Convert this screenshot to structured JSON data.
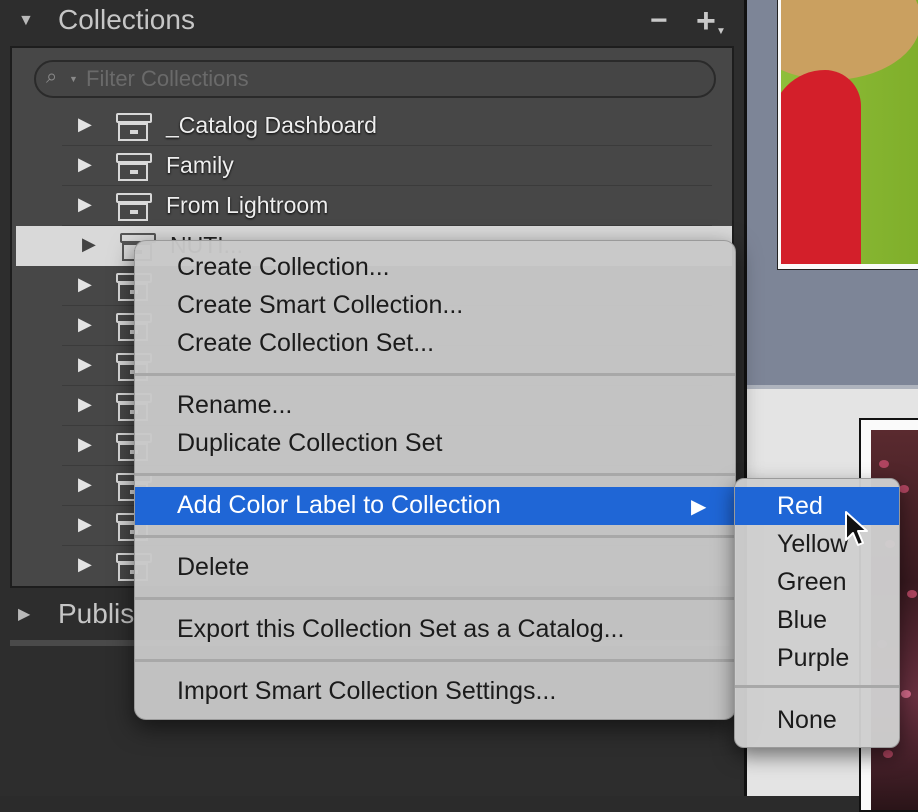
{
  "collections_panel": {
    "title": "Collections",
    "minus_symbol": "−",
    "plus_symbol": "+",
    "filter_placeholder": "Filter Collections",
    "rows": [
      {
        "label": "_Catalog Dashboard"
      },
      {
        "label": "Family"
      },
      {
        "label": "From Lightroom"
      },
      {
        "label": "NUTI..."
      },
      {
        "label": ""
      },
      {
        "label": ""
      },
      {
        "label": ""
      },
      {
        "label": ""
      },
      {
        "label": ""
      },
      {
        "label": ""
      },
      {
        "label": ""
      },
      {
        "label": ""
      }
    ]
  },
  "publish_panel": {
    "title": "Publis"
  },
  "context_menu": {
    "items": [
      "Create Collection...",
      "Create Smart Collection...",
      "Create Collection Set...",
      "Rename...",
      "Duplicate Collection Set",
      "Add Color Label to Collection",
      "Delete",
      "Export this Collection Set as a Catalog...",
      "Import Smart Collection Settings..."
    ],
    "highlighted_item": "Add Color Label to Collection"
  },
  "color_submenu": {
    "items": [
      "Red",
      "Yellow",
      "Green",
      "Blue",
      "Purple",
      "None"
    ],
    "highlighted_item": "Red"
  },
  "colors": {
    "highlight_blue": "#1f66d6",
    "panel_bg": "#474747"
  }
}
